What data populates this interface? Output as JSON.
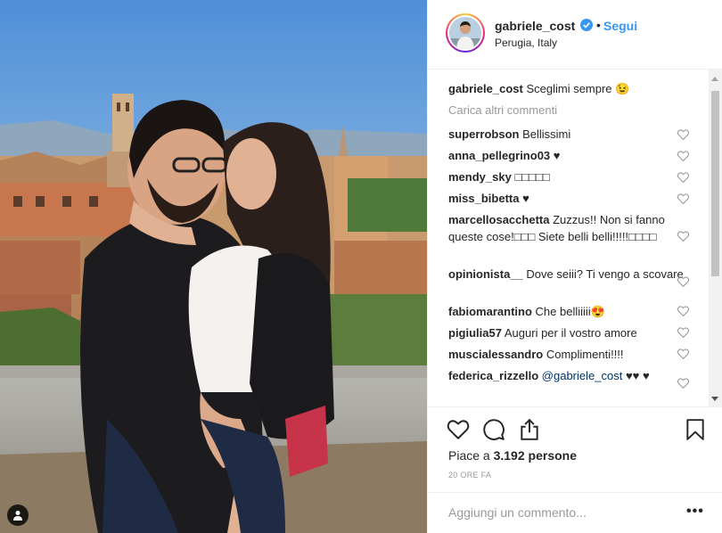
{
  "post": {
    "username": "gabriele_cost",
    "follow_label": "Segui",
    "dot": "•",
    "location": "Perugia, Italy",
    "caption": {
      "user": "gabriele_cost",
      "text": "Sceglimi sempre 😉"
    },
    "load_more": "Carica altri commenti",
    "likes_prefix": "Piace a ",
    "likes_count": "3.192",
    "likes_suffix": " persone",
    "timestamp": "20 ORE FA",
    "comment_placeholder": "Aggiungi un commento...",
    "more_label": "•••"
  },
  "comments": [
    {
      "user": "superrobson",
      "text": "Bellissimi"
    },
    {
      "user": "anna_pellegrino03",
      "text": "♥"
    },
    {
      "user": "mendy_sky",
      "text": "□□□□□"
    },
    {
      "user": "miss_bibetta",
      "text": "♥"
    },
    {
      "user": "marcellosacchetta",
      "text": "Zuzzus!! Non si fanno queste cose!□□□ Siete belli belli!!!!!□□□□"
    },
    {
      "user": "opinionista__",
      "text": "Dove seiii? Ti vengo a scovare"
    },
    {
      "user": "fabiomarantino",
      "text": "Che belliiiii😍"
    },
    {
      "user": "pigiulia57",
      "text": "Auguri per il vostro amore"
    },
    {
      "user": "muscialessandro",
      "text": "Complimenti!!!!"
    },
    {
      "user": "federica_rizzello",
      "mention": "@gabriele_cost",
      "text": "♥♥ ♥"
    }
  ],
  "icons": {
    "like": "heart-icon",
    "comment": "comment-icon",
    "share": "share-icon",
    "save": "bookmark-icon",
    "verified": "verified-badge-icon",
    "tag": "user-tag-icon"
  },
  "colors": {
    "link_blue": "#3897f0",
    "verified_blue": "#3897f0",
    "text": "#262626",
    "muted": "#999999"
  }
}
